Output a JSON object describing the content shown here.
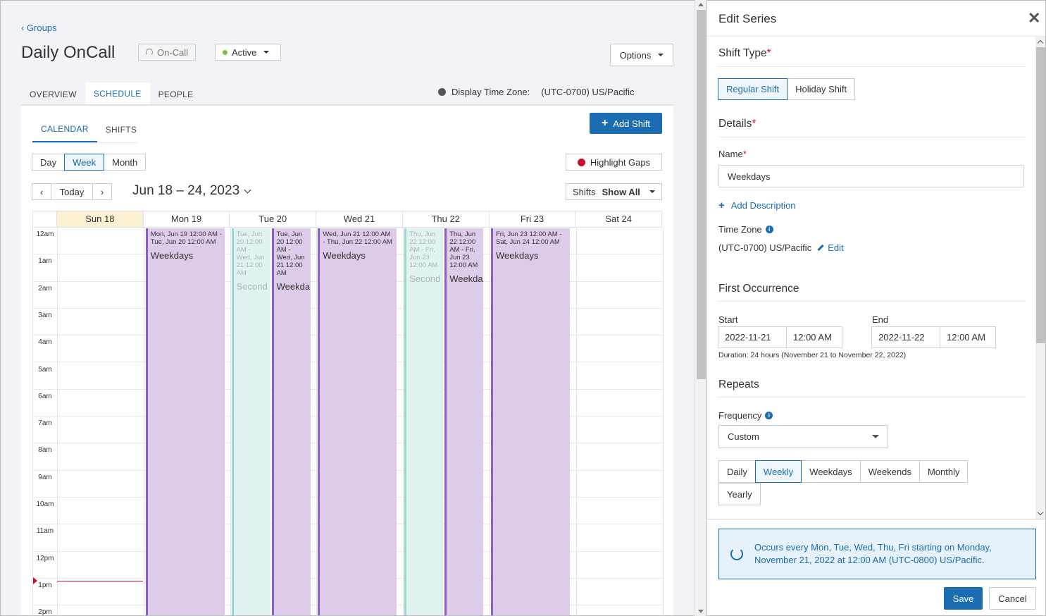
{
  "header": {
    "back_link": "‹ Groups",
    "title": "Daily OnCall",
    "oncall_chip": "On-Call",
    "status_chip": "Active",
    "options_label": "Options"
  },
  "main_tabs": [
    {
      "label": "OVERVIEW",
      "active": false
    },
    {
      "label": "SCHEDULE",
      "active": true
    },
    {
      "label": "PEOPLE",
      "active": false
    }
  ],
  "timezone": {
    "label": "Display Time Zone:",
    "value": "(UTC-0700) US/Pacific"
  },
  "sub_tabs": [
    {
      "label": "CALENDAR",
      "active": true
    },
    {
      "label": "SHIFTS",
      "active": false
    }
  ],
  "add_shift_label": "Add Shift",
  "view_modes": [
    {
      "label": "Day",
      "active": false
    },
    {
      "label": "Week",
      "active": true
    },
    {
      "label": "Month",
      "active": false
    }
  ],
  "highlight_gaps_label": "Highlight Gaps",
  "nav": {
    "today_label": "Today",
    "date_range": "Jun 18 – 24, 2023"
  },
  "shifts_filter": {
    "label": "Shifts",
    "value": "Show All"
  },
  "calendar": {
    "days": [
      {
        "label": "Sun 18",
        "today": true
      },
      {
        "label": "Mon 19"
      },
      {
        "label": "Tue 20"
      },
      {
        "label": "Wed 21"
      },
      {
        "label": "Thu 22"
      },
      {
        "label": "Fri 23"
      },
      {
        "label": "Sat 24"
      }
    ],
    "hours": [
      "12am",
      "1am",
      "2am",
      "3am",
      "4am",
      "5am",
      "6am",
      "7am",
      "8am",
      "9am",
      "10am",
      "11am",
      "12pm",
      "1pm",
      "2pm"
    ],
    "events": [
      {
        "time": "Mon, Jun 19 12:00 AM - Tue, Jun 20 12:00 AM",
        "name": "Weekdays",
        "style": "purple"
      },
      {
        "time": "Tue, Jun 20 12:00 AM - Wed, Jun 21 12:00 AM",
        "name": "Second",
        "style": "teal"
      },
      {
        "time": "Tue, Jun 20 12:00 AM - Wed, Jun 21 12:00 AM",
        "name": "Weekda",
        "style": "purple"
      },
      {
        "time": "Wed, Jun 21 12:00 AM - Thu, Jun 22 12:00 AM",
        "name": "Weekdays",
        "style": "purple"
      },
      {
        "time": "Thu, Jun 22 12:00 AM - Fri, Jun 23 12:00 AM",
        "name": "Second",
        "style": "teal"
      },
      {
        "time": "Thu, Jun 22 12:00 AM - Fri, Jun 23 12:00 AM",
        "name": "Weekda",
        "style": "purple"
      },
      {
        "time": "Fri, Jun 23 12:00 AM - Sat, Jun 24 12:00 AM",
        "name": "Weekdays",
        "style": "purple"
      }
    ]
  },
  "panel": {
    "title": "Edit Series",
    "shift_type": {
      "title": "Shift Type",
      "options": [
        {
          "label": "Regular Shift",
          "active": true
        },
        {
          "label": "Holiday Shift",
          "active": false
        }
      ]
    },
    "details_title": "Details",
    "name_label": "Name",
    "name_value": "Weekdays",
    "add_description_label": "Add Description",
    "timezone_label": "Time Zone",
    "timezone_value": "(UTC-0700) US/Pacific",
    "edit_label": "Edit",
    "first_occurrence_title": "First Occurrence",
    "start_label": "Start",
    "start_date": "2022-11-21",
    "start_time": "12:00 AM",
    "end_label": "End",
    "end_date": "2022-11-22",
    "end_time": "12:00 AM",
    "duration_text": "Duration: 24 hours (November 21 to November 22, 2022)",
    "repeats_title": "Repeats",
    "frequency_label": "Frequency",
    "frequency_value": "Custom",
    "frequency_options": [
      {
        "label": "Daily",
        "active": false
      },
      {
        "label": "Weekly",
        "active": true
      },
      {
        "label": "Weekdays",
        "active": false
      },
      {
        "label": "Weekends",
        "active": false
      },
      {
        "label": "Monthly",
        "active": false
      },
      {
        "label": "Yearly",
        "active": false
      }
    ],
    "summary_text": "Occurs every Mon, Tue, Wed, Thu, Fri starting on Monday, November 21, 2022 at 12:00 AM (UTC-0800) US/Pacific.",
    "save_label": "Save",
    "cancel_label": "Cancel"
  },
  "colors": {
    "accent": "#1b6cb0",
    "shift_purple": "#dcccea",
    "shift_purple_border": "#8e5cc6",
    "shift_teal": "#e0f3f2",
    "today_header": "#fcf0d3",
    "required": "#c8102e",
    "active_dot": "#7cc142"
  }
}
